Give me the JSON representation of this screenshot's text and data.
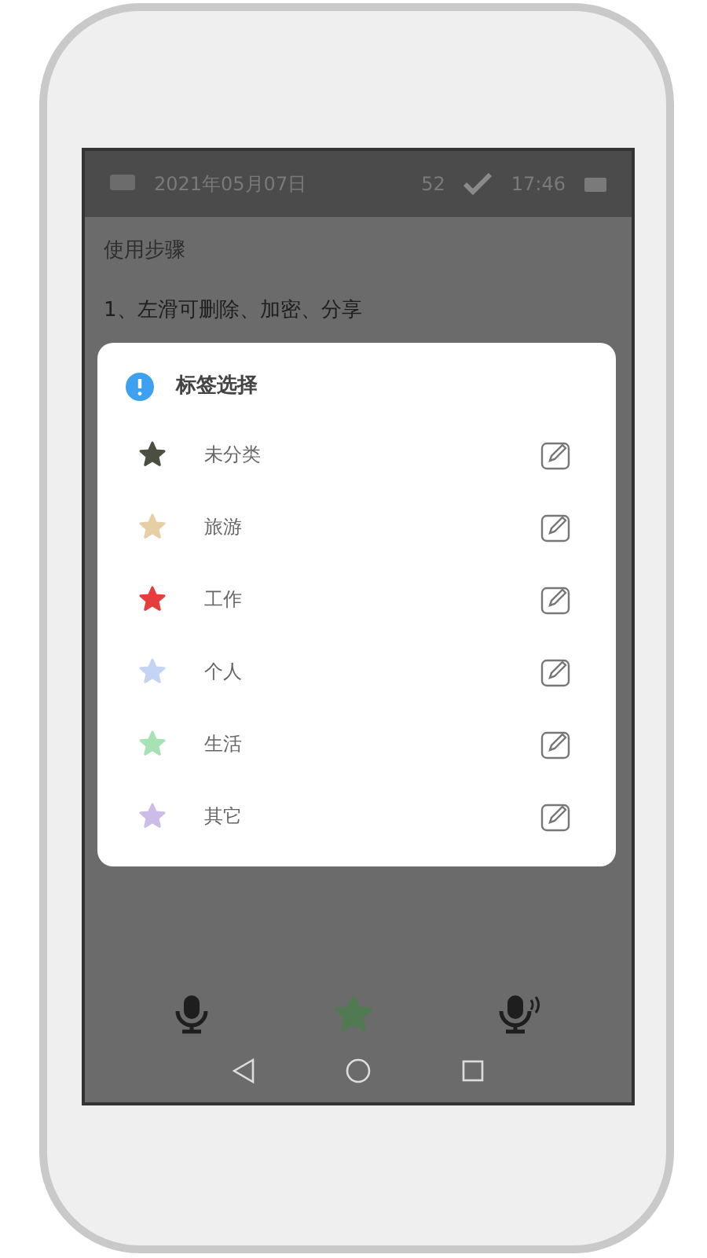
{
  "status_bar": {
    "date": "2021年05月07日",
    "count": "52",
    "time": "17:46"
  },
  "content": {
    "heading": "使用步骤",
    "lines": [
      "1、左滑可删除、加密、分享"
    ]
  },
  "dialog": {
    "title": "标签选择",
    "tags": [
      {
        "label": "未分类",
        "color": "#4b4f42"
      },
      {
        "label": "旅游",
        "color": "#e6cfa5"
      },
      {
        "label": "工作",
        "color": "#e63d3d"
      },
      {
        "label": "个人",
        "color": "#c4d4f2"
      },
      {
        "label": "生活",
        "color": "#a8e2b4"
      },
      {
        "label": "其它",
        "color": "#cdbde6"
      }
    ]
  }
}
